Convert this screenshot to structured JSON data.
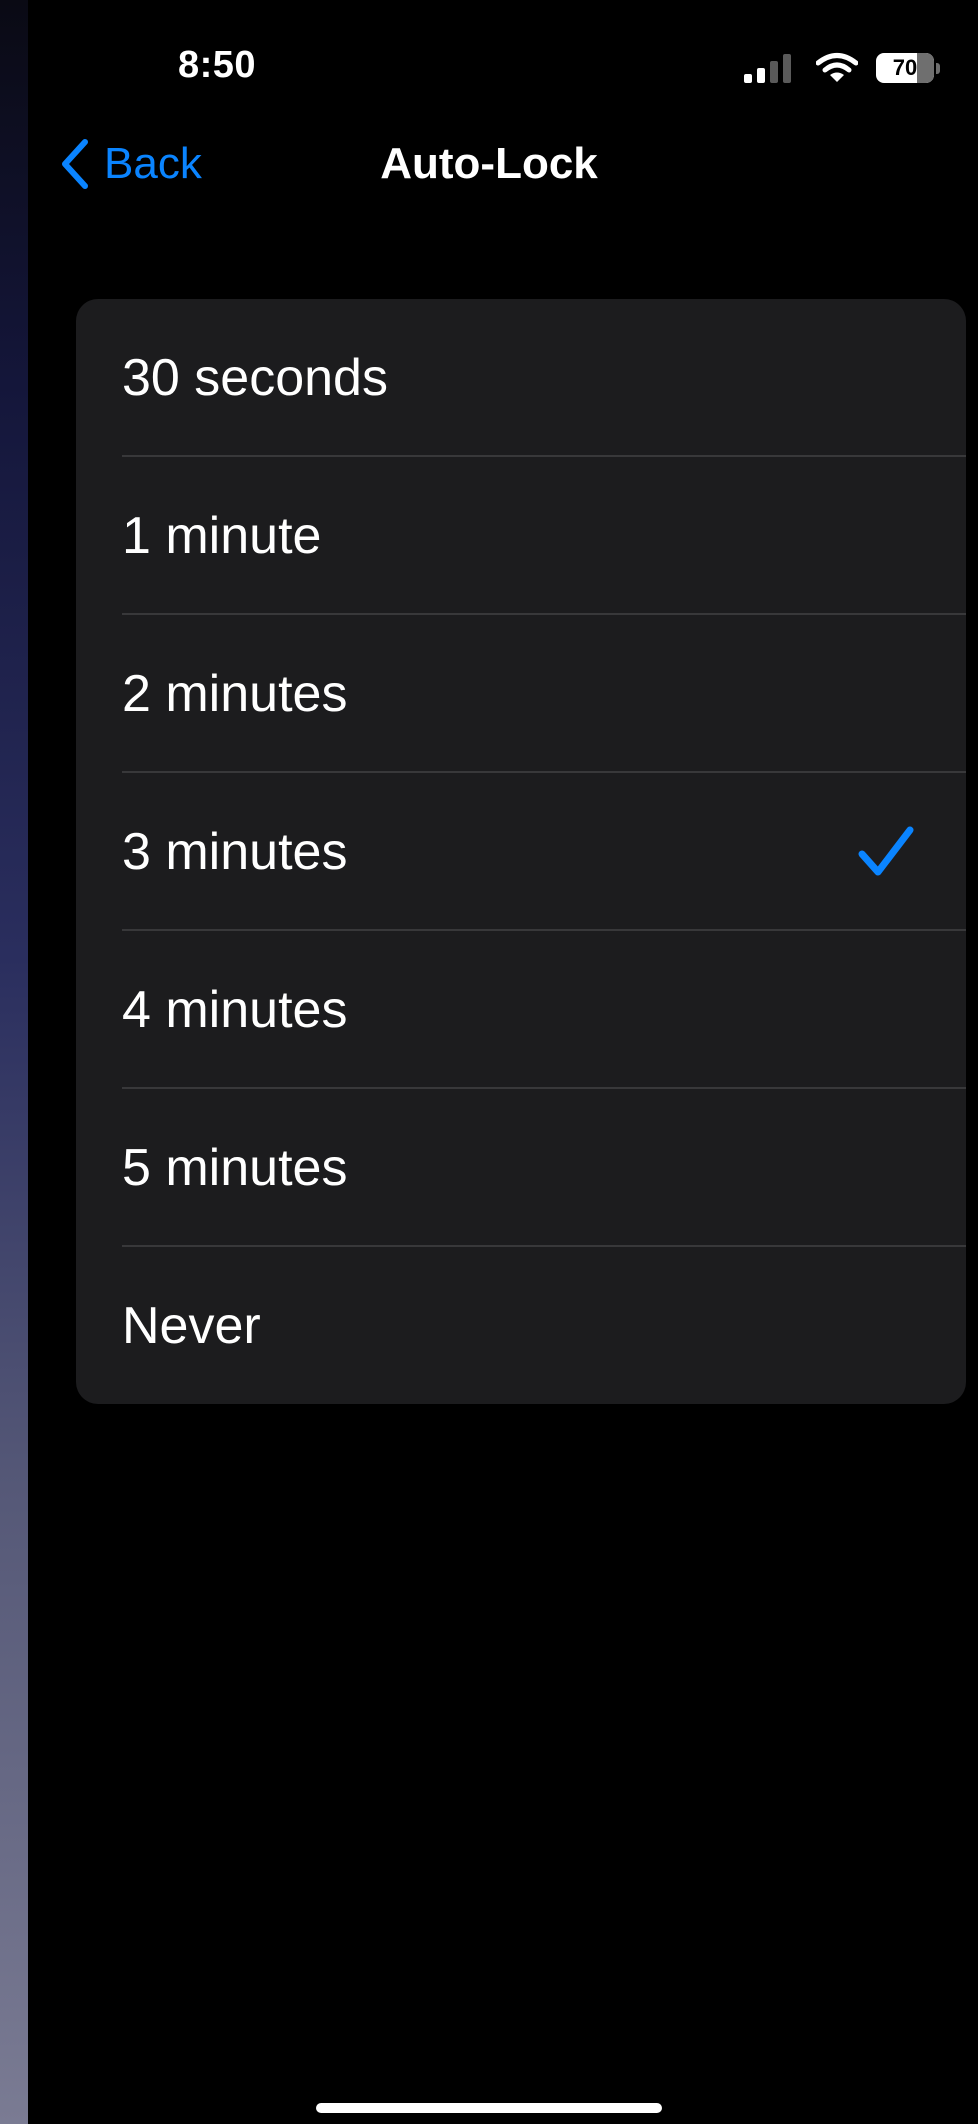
{
  "status_bar": {
    "time": "8:50",
    "battery_level": "70",
    "icons": [
      "signal-icon",
      "wifi-icon",
      "battery-icon"
    ]
  },
  "nav": {
    "back_label": "Back",
    "title": "Auto-Lock"
  },
  "options": [
    {
      "label": "30 seconds",
      "selected": false
    },
    {
      "label": "1 minute",
      "selected": false
    },
    {
      "label": "2 minutes",
      "selected": false
    },
    {
      "label": "3 minutes",
      "selected": true
    },
    {
      "label": "4 minutes",
      "selected": false
    },
    {
      "label": "5 minutes",
      "selected": false
    },
    {
      "label": "Never",
      "selected": false
    }
  ],
  "colors": {
    "accent": "#0a84ff",
    "background": "#000000",
    "card": "#1c1c1e",
    "separator": "#38383a",
    "text": "#ffffff"
  }
}
